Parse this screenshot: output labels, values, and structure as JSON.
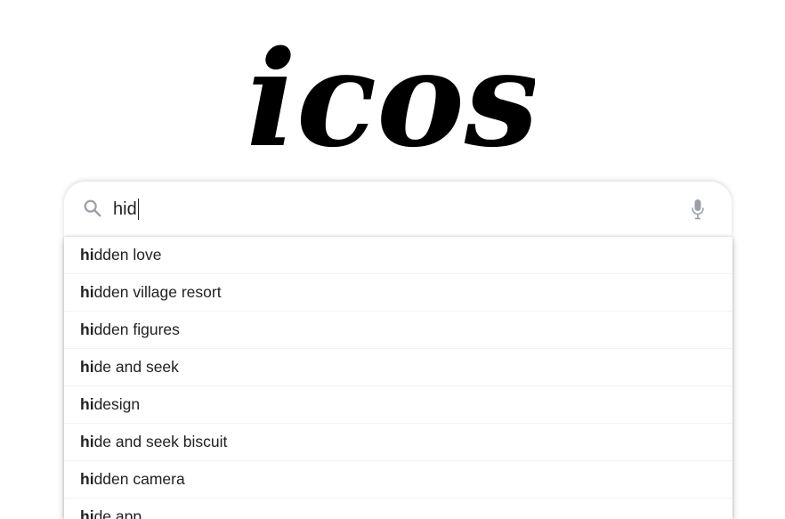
{
  "logo": {
    "text": "icos"
  },
  "search": {
    "value": "hid",
    "matched_prefix": "hi"
  },
  "suggestions": [
    {
      "prefix": "hi",
      "rest": "dden love"
    },
    {
      "prefix": "hi",
      "rest": "dden village resort"
    },
    {
      "prefix": "hi",
      "rest": "dden figures"
    },
    {
      "prefix": "hi",
      "rest": "de and seek"
    },
    {
      "prefix": "hi",
      "rest": "design"
    },
    {
      "prefix": "hi",
      "rest": "de and seek biscuit"
    },
    {
      "prefix": "hi",
      "rest": "dden camera"
    },
    {
      "prefix": "hi",
      "rest": "de app"
    }
  ],
  "icons": {
    "search": "search-icon",
    "mic": "mic-icon"
  },
  "colors": {
    "text": "#202124",
    "icon": "#9aa0a6",
    "divider": "#f1f3f4"
  }
}
